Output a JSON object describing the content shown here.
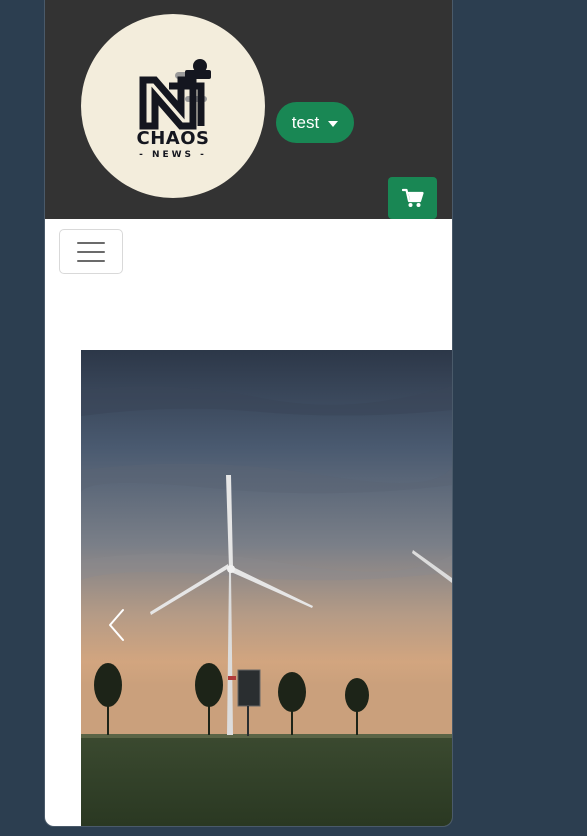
{
  "header": {
    "background": "#333333",
    "logo": {
      "title": "CHAOS",
      "subtitle": "- NEWS -",
      "background": "#f3eddc"
    },
    "user_dropdown": {
      "label": "test",
      "color": "#198754"
    },
    "cart": {
      "icon": "cart-icon",
      "color": "#198754"
    }
  },
  "nav": {
    "toggler_icon": "hamburger-icon"
  },
  "carousel": {
    "image_subject": "wind-turbines-at-sunset",
    "prev_icon": "chevron-left-icon"
  }
}
